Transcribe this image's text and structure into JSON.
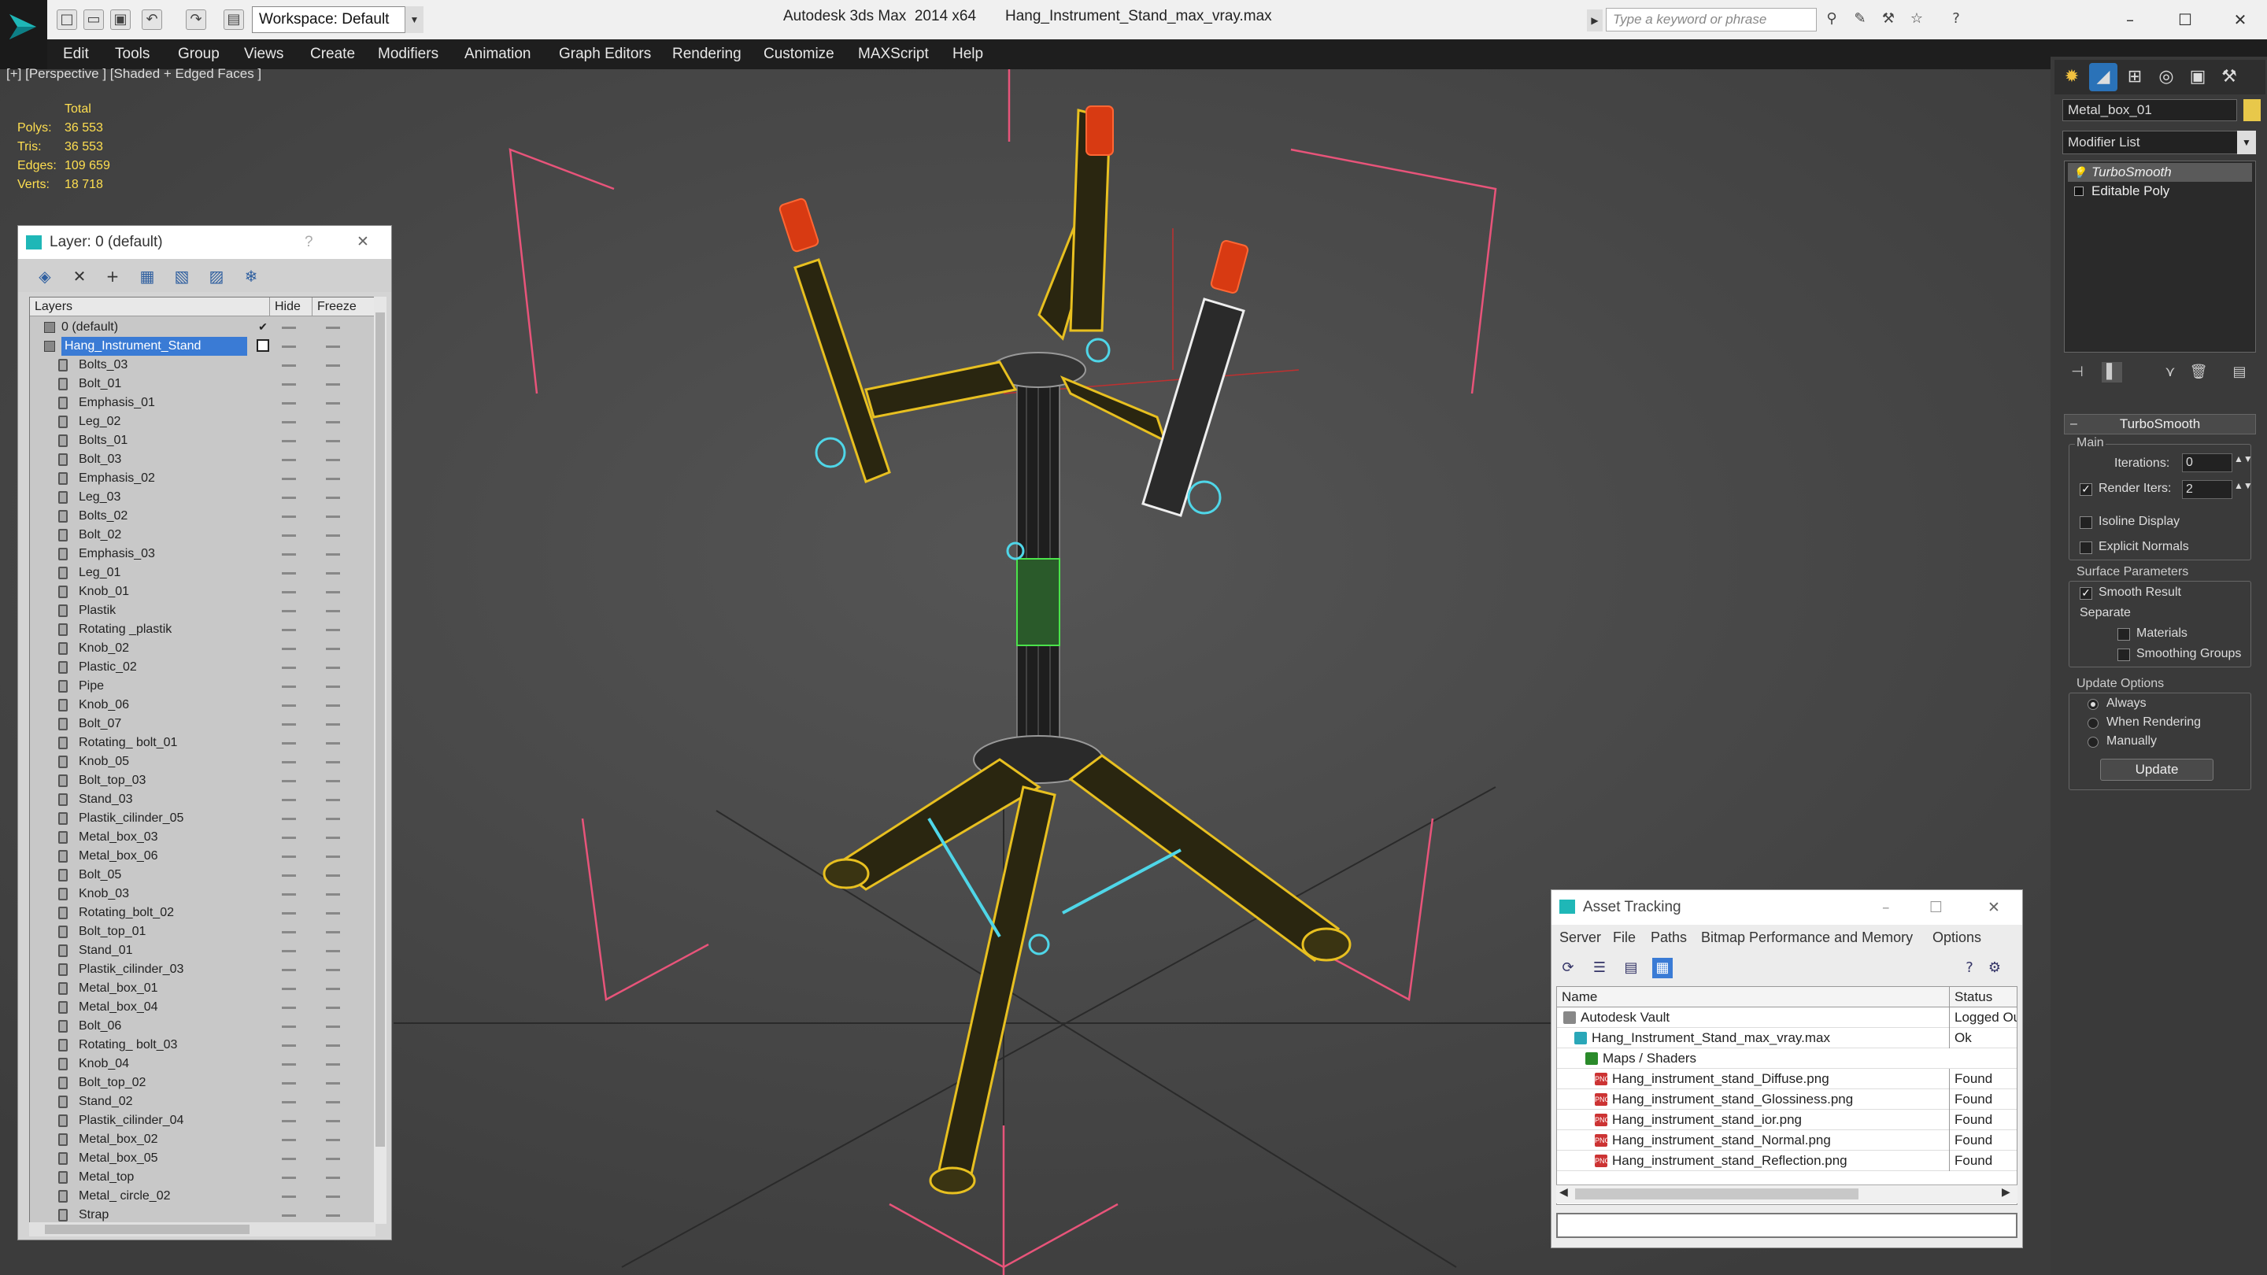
{
  "app": {
    "workspace_label": "Workspace: Default",
    "title": "Autodesk 3ds Max  2014 x64       Hang_Instrument_Stand_max_vray.max",
    "search_placeholder": "Type a keyword or phrase"
  },
  "menu": [
    "Edit",
    "Tools",
    "Group",
    "Views",
    "Create",
    "Modifiers",
    "Animation",
    "Graph Editors",
    "Rendering",
    "Customize",
    "MAXScript",
    "Help"
  ],
  "viewport": {
    "label": "[+] [Perspective ] [Shaded + Edged Faces ]",
    "stats": {
      "header": "Total",
      "rows": [
        {
          "label": "Polys:",
          "value": "36 553"
        },
        {
          "label": "Tris:",
          "value": "36 553"
        },
        {
          "label": "Edges:",
          "value": "109 659"
        },
        {
          "label": "Verts:",
          "value": "18 718"
        }
      ]
    }
  },
  "layer_panel": {
    "title": "Layer: 0 (default)",
    "help": "?",
    "close": "✕",
    "col_layers": "Layers",
    "col_hide": "Hide",
    "col_freeze": "Freeze",
    "layers": [
      {
        "name": "0 (default)",
        "level": 0
      },
      {
        "name": "Hang_Instrument_Stand",
        "level": 0,
        "selected": true
      }
    ],
    "objects": [
      "Bolts_03",
      "Bolt_01",
      "Emphasis_01",
      "Leg_02",
      "Bolts_01",
      "Bolt_03",
      "Emphasis_02",
      "Leg_03",
      "Bolts_02",
      "Bolt_02",
      "Emphasis_03",
      "Leg_01",
      "Knob_01",
      "Plastik",
      "Rotating _plastik",
      "Knob_02",
      "Plastic_02",
      "Pipe",
      "Knob_06",
      "Bolt_07",
      "Rotating_ bolt_01",
      "Knob_05",
      "Bolt_top_03",
      "Stand_03",
      "Plastik_cilinder_05",
      "Metal_box_03",
      "Metal_box_06",
      "Bolt_05",
      "Knob_03",
      "Rotating_bolt_02",
      "Bolt_top_01",
      "Stand_01",
      "Plastik_cilinder_03",
      "Metal_box_01",
      "Metal_box_04",
      "Bolt_06",
      "Rotating_ bolt_03",
      "Knob_04",
      "Bolt_top_02",
      "Stand_02",
      "Plastik_cilinder_04",
      "Metal_box_02",
      "Metal_box_05",
      "Metal_top",
      "Metal_ circle_02",
      "Strap"
    ]
  },
  "command_panel": {
    "object_name": "Metal_box_01",
    "object_color": "#e8c84a",
    "modifier_list": "Modifier List",
    "stack": [
      "TurboSmooth",
      "Editable Poly"
    ],
    "rollout_title": "TurboSmooth",
    "main_group": "Main",
    "iterations_label": "Iterations:",
    "iterations_value": "0",
    "render_iters_label": "Render Iters:",
    "render_iters_value": "2",
    "isoline": "Isoline Display",
    "explicit_normals": "Explicit Normals",
    "surface_group": "Surface Parameters",
    "smooth_result": "Smooth Result",
    "separate": "Separate",
    "materials": "Materials",
    "smoothing_groups": "Smoothing Groups",
    "update_group": "Update Options",
    "always": "Always",
    "when_rendering": "When Rendering",
    "manually": "Manually",
    "update_btn": "Update"
  },
  "asset_tracking": {
    "title": "Asset Tracking",
    "menu": [
      "Server",
      "File",
      "Paths",
      "Bitmap Performance and Memory",
      "Options"
    ],
    "col_name": "Name",
    "col_status": "Status",
    "rows": [
      {
        "name": "Autodesk Vault",
        "status": "Logged Ou",
        "indent": 30,
        "icon": "vault-icon"
      },
      {
        "name": "Hang_Instrument_Stand_max_vray.max",
        "status": "Ok",
        "indent": 44,
        "icon": "max-file-icon"
      },
      {
        "name": "Maps / Shaders",
        "status": "",
        "indent": 58,
        "icon": "folder-icon"
      },
      {
        "name": "Hang_instrument_stand_Diffuse.png",
        "status": "Found",
        "indent": 70,
        "icon": "png-icon"
      },
      {
        "name": "Hang_instrument_stand_Glossiness.png",
        "status": "Found",
        "indent": 70,
        "icon": "png-icon"
      },
      {
        "name": "Hang_instrument_stand_ior.png",
        "status": "Found",
        "indent": 70,
        "icon": "png-icon"
      },
      {
        "name": "Hang_instrument_stand_Normal.png",
        "status": "Found",
        "indent": 70,
        "icon": "png-icon"
      },
      {
        "name": "Hang_instrument_stand_Reflection.png",
        "status": "Found",
        "indent": 70,
        "icon": "png-icon"
      }
    ]
  }
}
